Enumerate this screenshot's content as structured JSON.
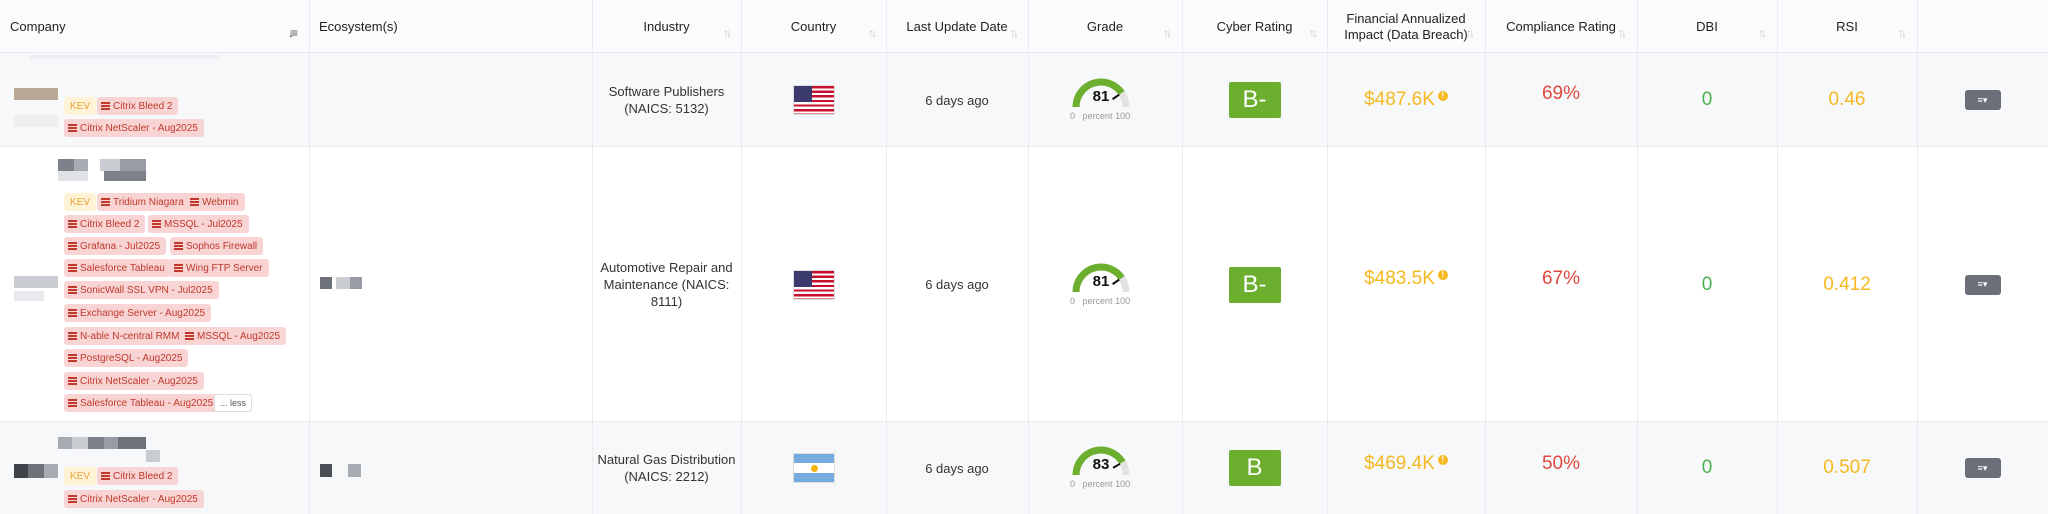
{
  "header": {
    "company": "Company",
    "ecosystem": "Ecosystem(s)",
    "industry": "Industry",
    "country": "Country",
    "last_update": "Last Update Date",
    "grade": "Grade",
    "cyber_rating": "Cyber Rating",
    "financial_line1": "Financial Annualized",
    "financial_line2": "Impact (Data Breach)",
    "compliance": "Compliance Rating",
    "dbi": "DBI",
    "rsi": "RSI",
    "sort_icon": "sort-icon"
  },
  "rows": [
    {
      "badges": [
        "KEV"
      ],
      "tags": [
        "Citrix Bleed 2",
        "Citrix NetScaler - Aug2025"
      ],
      "industry_line1": "Software Publishers",
      "industry_line2": "(NAICS: 5132)",
      "country_flag": "us-flag",
      "last_update": "6 days ago",
      "grade": "81",
      "grade_min": "0",
      "grade_label": "percent",
      "grade_max": "100",
      "cyber_rating": "B-",
      "financial_impact": "$487.6K",
      "compliance": "69%",
      "dbi": "0",
      "rsi": "0.46"
    },
    {
      "badges": [
        "KEV"
      ],
      "tags": [
        "Tridium Niagara",
        "Webmin",
        "Citrix Bleed 2",
        "MSSQL - Jul2025",
        "Grafana - Jul2025",
        "Sophos Firewall",
        "Salesforce Tableau",
        "Wing FTP Server",
        "SonicWall SSL VPN - Jul2025",
        "Exchange Server - Aug2025",
        "N-able N-central RMM",
        "MSSQL - Aug2025",
        "PostgreSQL - Aug2025",
        "Citrix NetScaler - Aug2025",
        "Salesforce Tableau - Aug2025"
      ],
      "less_label": "... less",
      "industry_line1": "Automotive Repair and",
      "industry_line2": "Maintenance (NAICS:",
      "industry_line3": "8111)",
      "country_flag": "us-flag",
      "last_update": "6 days ago",
      "grade": "81",
      "grade_min": "0",
      "grade_label": "percent",
      "grade_max": "100",
      "cyber_rating": "B-",
      "financial_impact": "$483.5K",
      "compliance": "67%",
      "dbi": "0",
      "rsi": "0.412"
    },
    {
      "badges": [
        "KEV"
      ],
      "tags": [
        "Citrix Bleed 2",
        "Citrix NetScaler - Aug2025"
      ],
      "industry_line1": "Natural Gas Distribution",
      "industry_line2": "(NAICS: 2212)",
      "country_flag": "ar-flag",
      "last_update": "6 days ago",
      "grade": "83",
      "grade_min": "0",
      "grade_label": "percent",
      "grade_max": "100",
      "cyber_rating": "B",
      "financial_impact": "$469.4K",
      "compliance": "50%",
      "dbi": "0",
      "rsi": "0.507"
    }
  ],
  "colors": {
    "grade_arc": "#6cae2d",
    "rating_bg": "#6cae2d",
    "money": "#f5b820",
    "compliance": "#e0483e",
    "dbi": "#4caf50",
    "rsi": "#f5b820",
    "tag_bg": "#f8d4d4",
    "kev_bg": "#fff3d6"
  }
}
